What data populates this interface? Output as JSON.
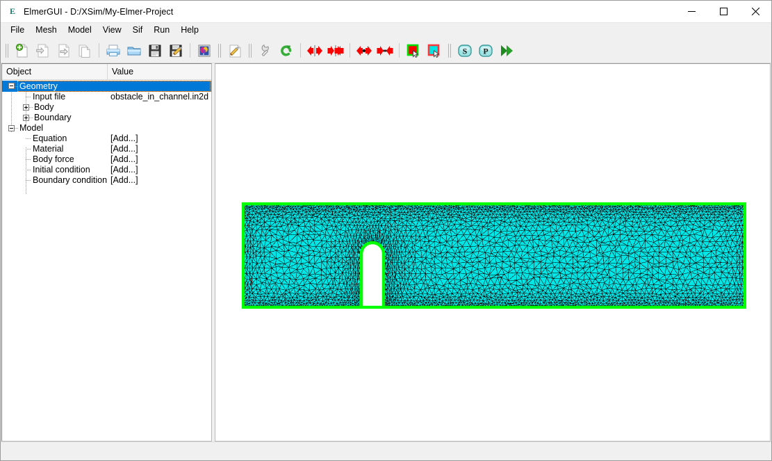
{
  "window": {
    "title": "ElmerGUI - D:/XSim/My-Elmer-Project",
    "app_icon": "E",
    "controls": {
      "minimize": "minimize-icon",
      "maximize": "maximize-icon",
      "close": "close-icon"
    }
  },
  "menubar": {
    "items": [
      {
        "label": "File"
      },
      {
        "label": "Mesh"
      },
      {
        "label": "Model"
      },
      {
        "label": "View"
      },
      {
        "label": "Sif"
      },
      {
        "label": "Run"
      },
      {
        "label": "Help"
      }
    ]
  },
  "toolbar": {
    "groups": [
      {
        "buttons": [
          {
            "icon": "new-document-icon",
            "tooltip": "New"
          },
          {
            "icon": "open-document-icon",
            "tooltip": "Open"
          },
          {
            "icon": "export-document-icon",
            "tooltip": "Export"
          },
          {
            "icon": "copy-document-icon",
            "tooltip": "Copy"
          }
        ]
      },
      {
        "buttons": [
          {
            "icon": "print-icon",
            "tooltip": "Print"
          },
          {
            "icon": "folder-open-icon",
            "tooltip": "Open folder"
          },
          {
            "icon": "save-floppy-icon",
            "tooltip": "Save"
          },
          {
            "icon": "save-as-floppy-icon",
            "tooltip": "Save as"
          }
        ]
      },
      {
        "buttons": [
          {
            "icon": "picture-icon",
            "tooltip": "Screenshot"
          }
        ]
      },
      {
        "buttons": [
          {
            "icon": "edit-pencil-icon",
            "tooltip": "Edit"
          }
        ]
      },
      {
        "buttons": [
          {
            "icon": "wrench-icon",
            "tooltip": "Mesh settings"
          },
          {
            "icon": "green-refresh-icon",
            "tooltip": "Remesh"
          }
        ]
      },
      {
        "buttons": [
          {
            "icon": "divide-surface-icon",
            "tooltip": "Divide surface"
          },
          {
            "icon": "unify-surface-icon",
            "tooltip": "Unify surface"
          }
        ]
      },
      {
        "buttons": [
          {
            "icon": "divide-edge-icon",
            "tooltip": "Divide edge"
          },
          {
            "icon": "unify-edge-icon",
            "tooltip": "Unify edge"
          }
        ]
      },
      {
        "buttons": [
          {
            "icon": "select-surface-icon",
            "tooltip": "Select surface"
          },
          {
            "icon": "select-edge-icon",
            "tooltip": "Select edge"
          }
        ]
      },
      {
        "buttons": [
          {
            "icon": "solver-input-file-icon",
            "label": "S",
            "tooltip": "Generate sif"
          },
          {
            "icon": "post-processing-icon",
            "label": "P",
            "tooltip": "Postprocessor"
          },
          {
            "icon": "run-solver-icon",
            "tooltip": "Run solver"
          }
        ]
      }
    ]
  },
  "tree": {
    "columns": [
      {
        "label": "Object"
      },
      {
        "label": "Value"
      }
    ],
    "rows": [
      {
        "label": "Geometry",
        "value": "",
        "level": 0,
        "expander": "minus",
        "selected": true
      },
      {
        "label": "Input file",
        "value": "obstacle_in_channel.in2d",
        "level": 1,
        "expander": "none",
        "selected": false
      },
      {
        "label": "Body",
        "value": "",
        "level": 1,
        "expander": "plus",
        "selected": false
      },
      {
        "label": "Boundary",
        "value": "",
        "level": 1,
        "expander": "plus",
        "selected": false
      },
      {
        "label": "Model",
        "value": "",
        "level": 0,
        "expander": "minus",
        "selected": false
      },
      {
        "label": "Equation",
        "value": "[Add...]",
        "level": 1,
        "expander": "none",
        "selected": false
      },
      {
        "label": "Material",
        "value": "[Add...]",
        "level": 1,
        "expander": "none",
        "selected": false
      },
      {
        "label": "Body force",
        "value": "[Add...]",
        "level": 1,
        "expander": "none",
        "selected": false
      },
      {
        "label": "Initial condition",
        "value": "[Add...]",
        "level": 1,
        "expander": "none",
        "selected": false
      },
      {
        "label": "Boundary condition",
        "value": "[Add...]",
        "level": 1,
        "expander": "none",
        "selected": false
      }
    ]
  },
  "viewport": {
    "mesh": {
      "name": "obstacle-in-channel-mesh",
      "boundary_color": "#00ff00",
      "element_fill_color": "#00e5e5",
      "element_edge_color": "#000000",
      "background_color": "#ffffff"
    }
  },
  "statusbar": {
    "text": ""
  },
  "colors": {
    "selection": "#0078d7",
    "window_bg": "#f0f0f0",
    "panel_bg": "#ffffff",
    "mesh_green": "#00ff00",
    "mesh_cyan": "#00e5e5"
  }
}
